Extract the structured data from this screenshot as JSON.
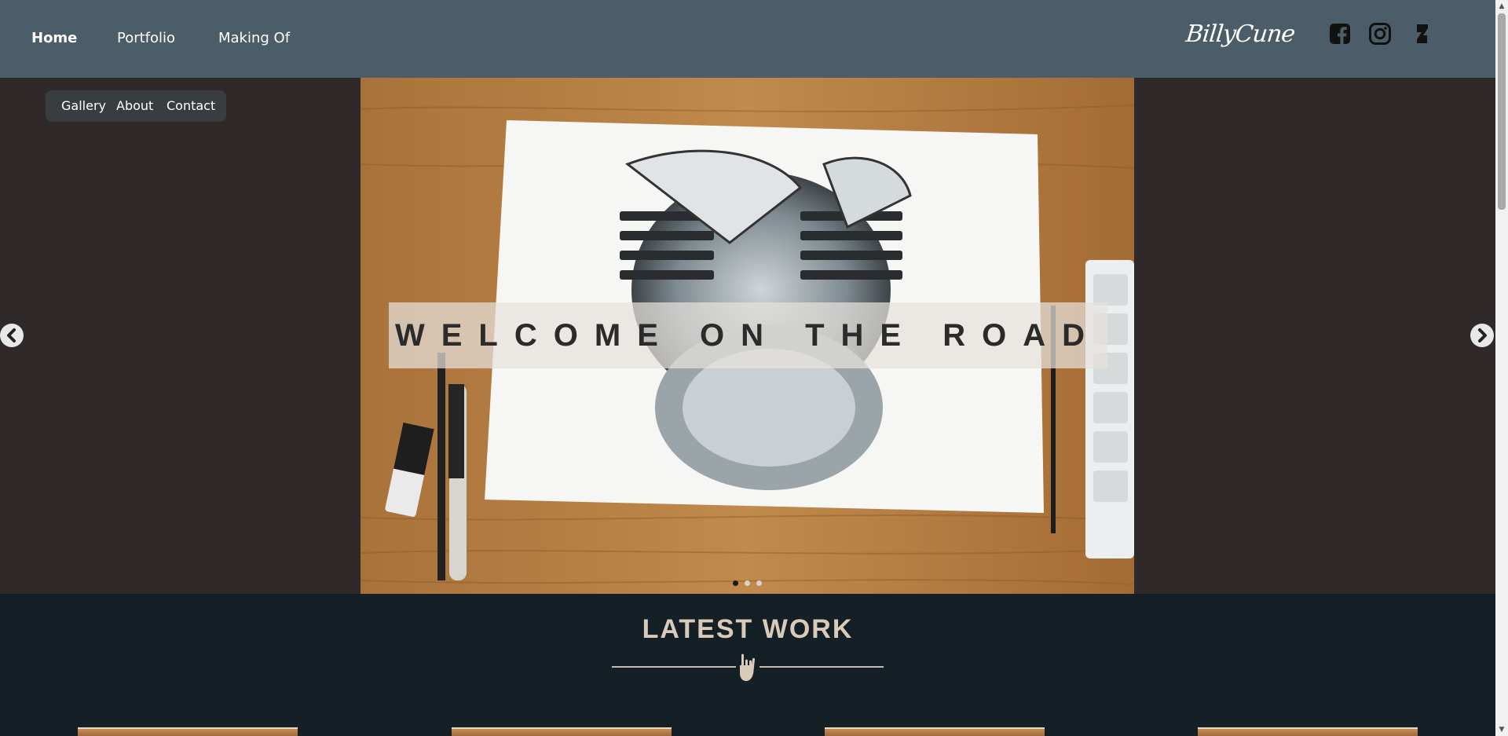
{
  "nav": {
    "items": [
      {
        "label": "Home",
        "active": true
      },
      {
        "label": "Portfolio",
        "active": false
      },
      {
        "label": "Making Of",
        "active": false
      }
    ]
  },
  "brand": {
    "name": "BillyCune"
  },
  "social": {
    "icons": [
      "facebook-icon",
      "instagram-icon",
      "deviantart-icon"
    ]
  },
  "subnav": {
    "items": [
      "Gallery",
      "About",
      "Contact"
    ]
  },
  "hero": {
    "caption": "WELCOME ON THE ROAD",
    "slide_count": 3,
    "active_slide": 1
  },
  "latest": {
    "title": "LATEST WORK"
  },
  "colors": {
    "topbar": "#4b5d68",
    "page_bg": "#2f2a29",
    "latest_bg": "#151f26",
    "accent_beige": "#d8cbb9"
  }
}
